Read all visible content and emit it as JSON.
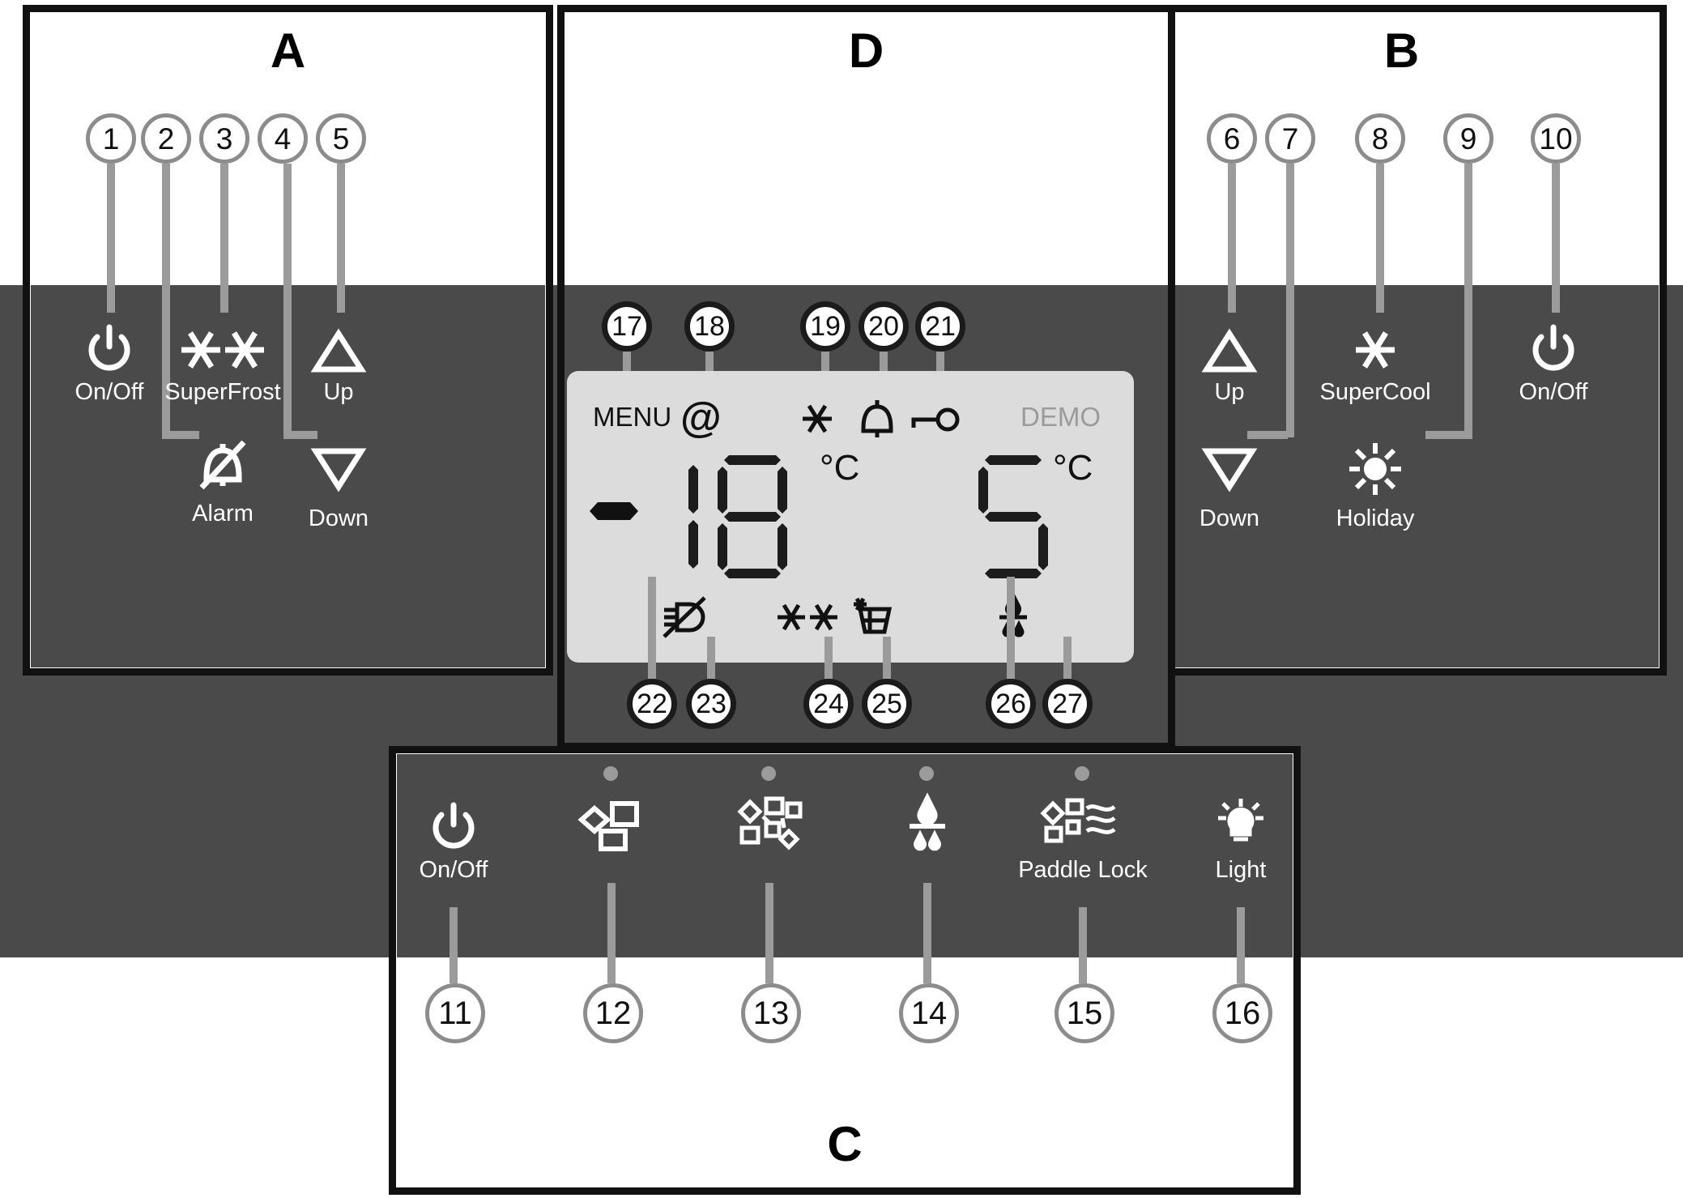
{
  "panels": {
    "a": {
      "letter": "A"
    },
    "b": {
      "letter": "B"
    },
    "c": {
      "letter": "C"
    },
    "d": {
      "letter": "D"
    }
  },
  "callouts": {
    "c1": "1",
    "c2": "2",
    "c3": "3",
    "c4": "4",
    "c5": "5",
    "c6": "6",
    "c7": "7",
    "c8": "8",
    "c9": "9",
    "c10": "10",
    "c11": "11",
    "c12": "12",
    "c13": "13",
    "c14": "14",
    "c15": "15",
    "c16": "16",
    "c17": "17",
    "c18": "18",
    "c19": "19",
    "c20": "20",
    "c21": "21",
    "c22": "22",
    "c23": "23",
    "c24": "24",
    "c25": "25",
    "c26": "26",
    "c27": "27"
  },
  "panel_a_keys": {
    "on_off": "On/Off",
    "superfrost": "SuperFrost",
    "up": "Up",
    "alarm": "Alarm",
    "down": "Down"
  },
  "panel_b_keys": {
    "up": "Up",
    "supercool": "SuperCool",
    "on_off": "On/Off",
    "down": "Down",
    "holiday": "Holiday"
  },
  "panel_c_keys": {
    "on_off": "On/Off",
    "icemaker": "",
    "max_ice": "",
    "water": "",
    "paddle_lock": "Paddle Lock",
    "light": "Light"
  },
  "lcd": {
    "menu": "MENU",
    "at": "@",
    "demo": "DEMO",
    "freezer_temp": "18",
    "freezer_minus": "-",
    "freezer_unit": "°C",
    "fridge_temp": "5",
    "fridge_unit": "°C"
  },
  "icons": {
    "power": "power-icon",
    "snowflake_double": "double-snowflake-icon",
    "snowflake": "snowflake-icon",
    "triangle_up": "triangle-up-icon",
    "triangle_down": "triangle-down-icon",
    "bell_crossed": "bell-crossed-icon",
    "bell": "bell-icon",
    "key": "key-icon",
    "sun": "sun-icon",
    "droplet": "water-droplet-icon",
    "icecube": "ice-cube-icon",
    "icemaker": "icemaker-icon",
    "paddle_lock": "paddle-lock-icon",
    "light_bulb": "light-bulb-icon",
    "plug_crossed": "plug-crossed-icon",
    "icebox": "ice-container-icon",
    "at_sign": "at-sign-icon"
  },
  "colors": {
    "panel_dark": "#4a4a4a",
    "panel_border": "#111111",
    "lcd_bg": "#dcdcdc",
    "leader_grey": "#9b9b9b",
    "demo_grey": "#9b9b9b"
  }
}
